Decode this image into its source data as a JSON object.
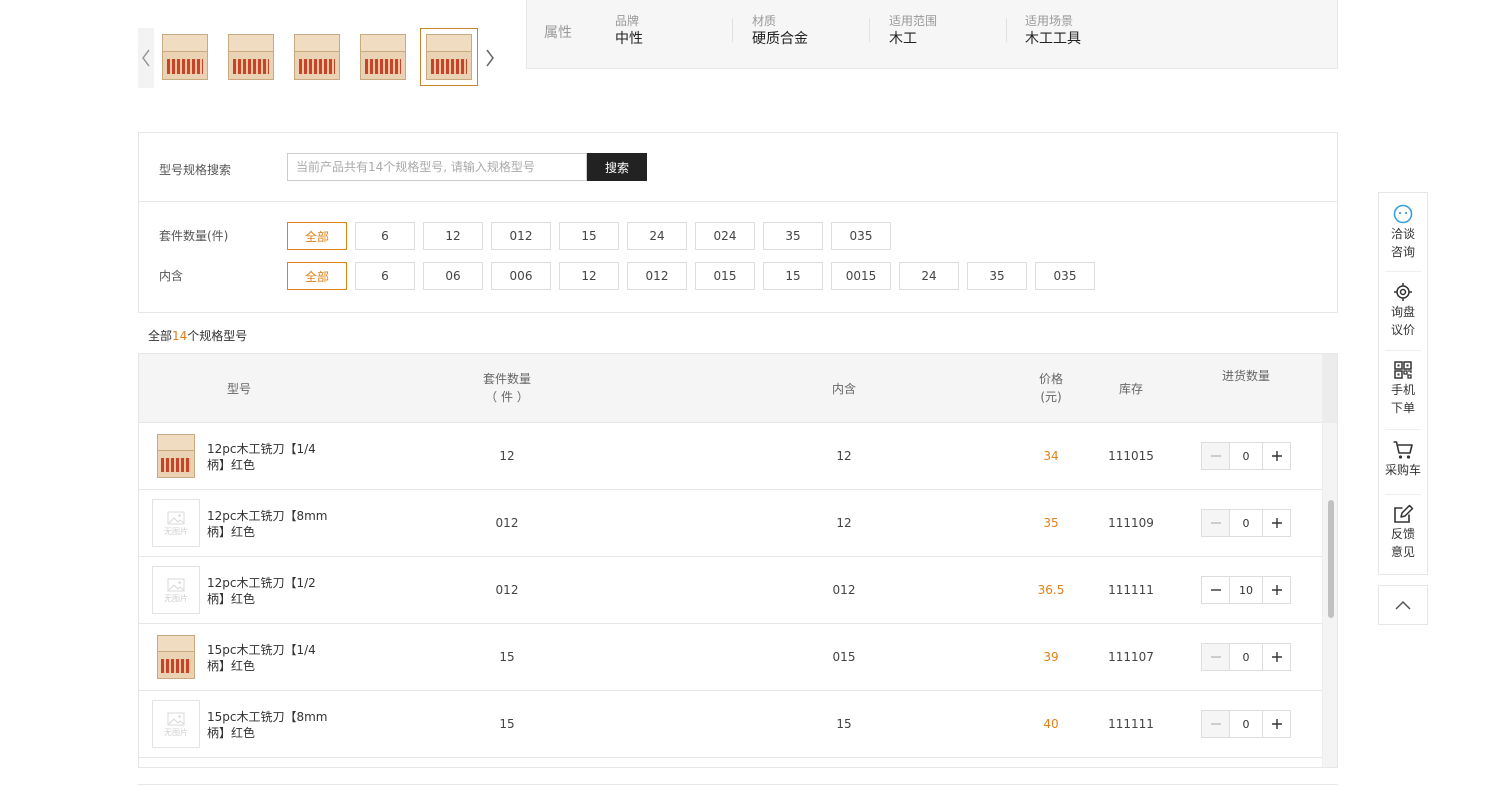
{
  "thumbnails": [
    {
      "alt": "router-bit-set-1",
      "active": false
    },
    {
      "alt": "router-bit-set-2",
      "active": false
    },
    {
      "alt": "router-bit-set-3",
      "active": false
    },
    {
      "alt": "router-bit-set-4",
      "active": false
    },
    {
      "alt": "router-bit-set-5",
      "active": true
    }
  ],
  "attributes": {
    "heading": "属性",
    "items": [
      {
        "key": "品牌",
        "value": "中性"
      },
      {
        "key": "材质",
        "value": "硬质合金"
      },
      {
        "key": "适用范围",
        "value": "木工"
      },
      {
        "key": "适用场景",
        "value": "木工工具"
      }
    ]
  },
  "filter": {
    "search_label": "型号规格搜索",
    "search_placeholder": "当前产品共有14个规格型号, 请输入规格型号",
    "search_value": "",
    "search_button": "搜索",
    "groups": [
      {
        "label": "套件数量(件)",
        "options": [
          "全部",
          "6",
          "12",
          "012",
          "15",
          "24",
          "024",
          "35",
          "035"
        ],
        "selected": "全部"
      },
      {
        "label": "内含",
        "options": [
          "全部",
          "6",
          "06",
          "006",
          "12",
          "012",
          "015",
          "15",
          "0015",
          "24",
          "35",
          "035"
        ],
        "selected": "全部"
      }
    ]
  },
  "summary": {
    "prefix": "全部",
    "count": "14",
    "suffix": "个规格型号"
  },
  "table": {
    "headers": {
      "model": "型号",
      "kit_qty_line1": "套件数量",
      "kit_qty_line2": "（ 件 ）",
      "contains": "内含",
      "price_line1": "价格",
      "price_line2": "(元)",
      "stock": "库存",
      "order_qty": "进货数量"
    },
    "no_image_text": "无图片",
    "rows": [
      {
        "name_line1": "12pc木工铣刀【1/4",
        "name_line2": "柄】红色",
        "has_image": true,
        "kit_qty": "12",
        "contains": "12",
        "price": "34",
        "stock": "111015",
        "qty": "0"
      },
      {
        "name_line1": "12pc木工铣刀【8mm",
        "name_line2": "柄】红色",
        "has_image": false,
        "kit_qty": "012",
        "contains": "12",
        "price": "35",
        "stock": "111109",
        "qty": "0"
      },
      {
        "name_line1": "12pc木工铣刀【1/2",
        "name_line2": "柄】红色",
        "has_image": false,
        "kit_qty": "012",
        "contains": "012",
        "price": "36.5",
        "stock": "111111",
        "qty": "10"
      },
      {
        "name_line1": "15pc木工铣刀【1/4",
        "name_line2": "柄】红色",
        "has_image": true,
        "kit_qty": "15",
        "contains": "015",
        "price": "39",
        "stock": "111107",
        "qty": "0"
      },
      {
        "name_line1": "15pc木工铣刀【8mm",
        "name_line2": "柄】红色",
        "has_image": false,
        "kit_qty": "15",
        "contains": "15",
        "price": "40",
        "stock": "111111",
        "qty": "0"
      }
    ]
  },
  "sidebar": {
    "items": [
      {
        "line1": "洽谈",
        "line2": "咨询",
        "icon": "chat-icon"
      },
      {
        "line1": "询盘",
        "line2": "议价",
        "icon": "target-icon"
      },
      {
        "line1": "手机",
        "line2": "下单",
        "icon": "qrcode-icon"
      },
      {
        "line1": "采购车",
        "line2": "",
        "icon": "cart-icon"
      },
      {
        "line1": "反馈",
        "line2": "意见",
        "icon": "edit-icon"
      }
    ],
    "back_to_top_icon": "chevron-up-icon"
  },
  "colors": {
    "accent": "#e0801a",
    "chat_icon": "#3aa0e0",
    "dark_button": "#222222"
  }
}
